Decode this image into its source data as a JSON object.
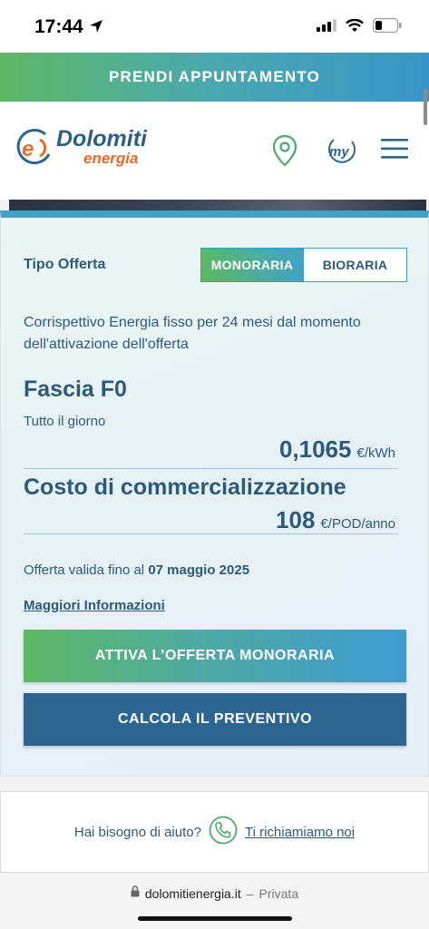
{
  "status_bar": {
    "time": "17:44"
  },
  "banner": {
    "label": "PRENDI APPUNTAMENTO"
  },
  "header": {
    "logo_main": "Dolomiti",
    "logo_sub": "energia",
    "account_icon_text": "my"
  },
  "offer": {
    "tipo_label": "Tipo Offerta",
    "options": [
      "MONORARIA",
      "BIORARIA"
    ],
    "selected": "MONORARIA",
    "description": "Corrispettivo Energia fisso per 24 mesi dal momento dell'attivazione dell'offerta",
    "fascia_title": "Fascia F0",
    "fascia_sub": "Tutto il giorno",
    "energy_price": "0,1065",
    "energy_unit": "€/kWh",
    "costo_title": "Costo di commercializzazione",
    "costo_value": "108",
    "costo_unit": "€/POD/anno",
    "validity_prefix": "Offerta valida fino al",
    "validity_date": "07 maggio 2025",
    "more_info": "Maggiori Informazioni",
    "activate_button": "ATTIVA L’OFFERTA MONORARIA",
    "quote_button": "CALCOLA IL PREVENTIVO"
  },
  "help": {
    "question": "Hai bisogno di aiuto?",
    "link": "Ti richiamiamo noi"
  },
  "url_bar": {
    "domain": "dolomitienergia.it",
    "separator": "–",
    "mode": "Privata"
  },
  "colors": {
    "brand_blue": "#2c6690",
    "brand_green": "#5cb865",
    "brand_orange": "#e86a2b",
    "text": "#2d5a7a"
  }
}
